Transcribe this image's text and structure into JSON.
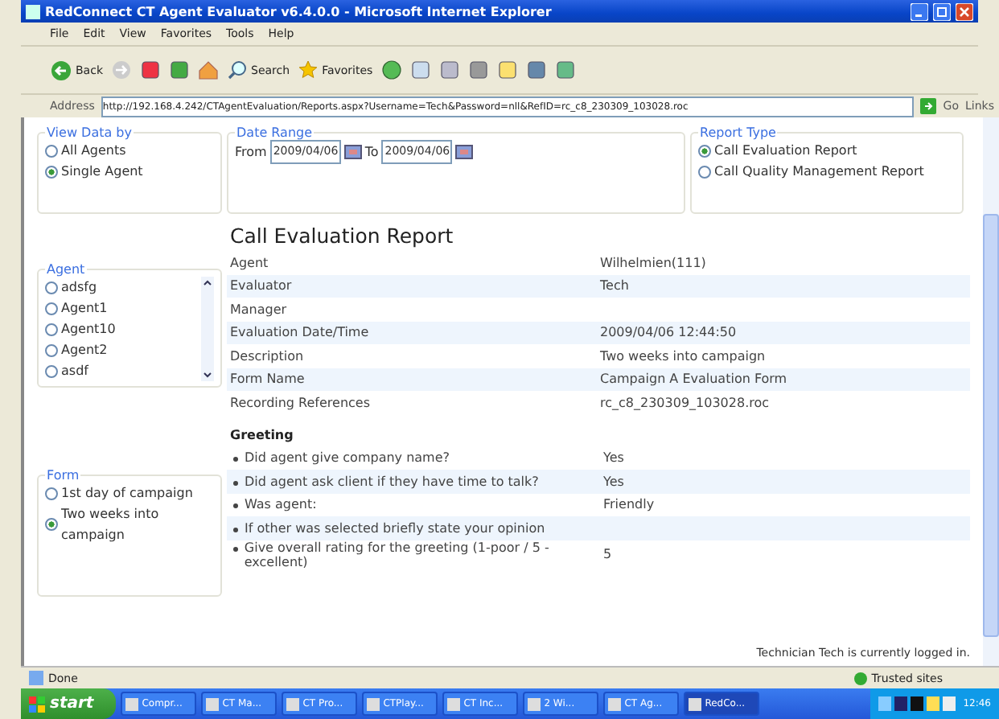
{
  "window": {
    "title": "RedConnect CT Agent Evaluator v6.4.0.0 - Microsoft Internet Explorer"
  },
  "menu": [
    "File",
    "Edit",
    "View",
    "Favorites",
    "Tools",
    "Help"
  ],
  "toolbar": [
    {
      "kind": "back",
      "label": "Back"
    },
    {
      "kind": "forward"
    },
    {
      "kind": "stop"
    },
    {
      "kind": "refresh"
    },
    {
      "kind": "home"
    },
    {
      "kind": "search",
      "label": "Search"
    },
    {
      "kind": "favorites",
      "label": "Favorites"
    },
    {
      "kind": "media"
    },
    {
      "kind": "mail"
    },
    {
      "kind": "print"
    },
    {
      "kind": "edit"
    },
    {
      "kind": "folder"
    },
    {
      "kind": "messenger"
    },
    {
      "kind": "people"
    }
  ],
  "address": {
    "label": "Address",
    "value": "http://192.168.4.242/CTAgentEvaluation/Reports.aspx?Username=Tech&Password=nll&RefID=rc_c8_230309_103028.roc",
    "go": "Go",
    "links": "Links"
  },
  "view_data_by": {
    "legend": "View Data by",
    "options": [
      {
        "label": "All Agents",
        "selected": false
      },
      {
        "label": "Single Agent",
        "selected": true
      }
    ]
  },
  "date_range": {
    "legend": "Date Range",
    "from_label": "From",
    "from": "2009/04/06",
    "to_label": "To",
    "to": "2009/04/06"
  },
  "report_type": {
    "legend": "Report Type",
    "options": [
      {
        "label": "Call Evaluation Report",
        "selected": true
      },
      {
        "label": "Call Quality Management Report",
        "selected": false
      }
    ]
  },
  "agent": {
    "legend": "Agent",
    "options": [
      {
        "label": "adsfg",
        "selected": false
      },
      {
        "label": "Agent1",
        "selected": false
      },
      {
        "label": "Agent10",
        "selected": false
      },
      {
        "label": "Agent2",
        "selected": false
      },
      {
        "label": "asdf",
        "selected": false
      }
    ]
  },
  "form": {
    "legend": "Form",
    "options": [
      {
        "label": "1st day of campaign",
        "selected": false
      },
      {
        "label": "Two weeks into campaign",
        "selected": true
      }
    ]
  },
  "report": {
    "title": "Call Evaluation Report",
    "rows": [
      {
        "label": "Agent",
        "value": "Wilhelmien(111)"
      },
      {
        "label": "Evaluator",
        "value": "Tech"
      },
      {
        "label": "Manager"
      },
      {
        "label": "Evaluation Date/Time",
        "value": "2009/04/06 12:44:50"
      },
      {
        "label": "Description",
        "value": "Two weeks into campaign"
      },
      {
        "label": "Form Name",
        "value": "Campaign A Evaluation Form"
      },
      {
        "label": "Recording References",
        "value": "rc_c8_230309_103028.roc"
      }
    ],
    "section": "Greeting",
    "questions": [
      {
        "question": "Did agent give company name?",
        "answer": "Yes"
      },
      {
        "question": "Did agent ask client if they have time to talk?",
        "answer": "Yes"
      },
      {
        "question": "Was agent:",
        "answer": "Friendly"
      },
      {
        "question": "If other was selected briefly state your opinion"
      },
      {
        "question": "Give overall rating for the greeting (1-poor / 5 - excellent)",
        "answer": "5"
      }
    ]
  },
  "login_note": "Technician Tech is currently logged in.",
  "status_bar": {
    "status": "Done",
    "zone": "Trusted sites"
  },
  "taskbar": {
    "start": "start",
    "tasks": [
      {
        "label": "Compr...",
        "selected": false
      },
      {
        "label": "CT Ma...",
        "selected": false
      },
      {
        "label": "CT Pro...",
        "selected": false
      },
      {
        "label": "CTPlay...",
        "selected": false
      },
      {
        "label": "CT Inc...",
        "selected": false
      },
      {
        "label": "2 Wi...",
        "selected": false
      },
      {
        "label": "CT Ag...",
        "selected": false
      },
      {
        "label": "RedCo...",
        "selected": true
      }
    ],
    "clock": "12:46"
  }
}
